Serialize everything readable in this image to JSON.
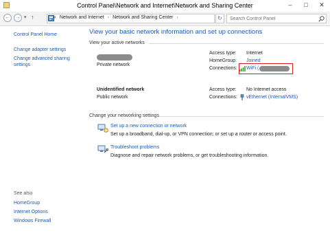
{
  "window": {
    "title": "Control Panel\\Network and Internet\\Network and Sharing Center",
    "minimize": "–",
    "maximize": "□",
    "close": "✕"
  },
  "nav": {
    "back": "←",
    "forward": "→",
    "dropdown": "▾",
    "up": "↑",
    "breadcrumb_chevron": "«",
    "breadcrumb": [
      "Network and Internet",
      "Network and Sharing Center"
    ],
    "separator": "›",
    "refresh": "↻",
    "search_placeholder": "Search Control Panel"
  },
  "sidebar": {
    "home": "Control Panel Home",
    "links": [
      "Change adapter settings",
      "Change advanced sharing settings"
    ],
    "see_also_title": "See also",
    "see_also": [
      "HomeGroup",
      "Internet Options",
      "Windows Firewall"
    ]
  },
  "main": {
    "heading": "View your basic network information and set up connections",
    "active_networks_title": "View your active networks",
    "networks": [
      {
        "name": "",
        "category": "Private network",
        "access_type_label": "Access type:",
        "access_type": "Internet",
        "homegroup_label": "HomeGroup:",
        "homegroup": "Joined",
        "connections_label": "Connections:",
        "connection": "WiFi ("
      },
      {
        "name": "Unidentified network",
        "category": "Public network",
        "access_type_label": "Access type:",
        "access_type": "No Internet access",
        "connections_label": "Connections:",
        "connection": "vEthernet (InternalVMS)"
      }
    ],
    "change_settings_title": "Change your networking settings",
    "settings": [
      {
        "link": "Set up a new connection or network",
        "desc": "Set up a broadband, dial-up, or VPN connection; or set up a router or access point."
      },
      {
        "link": "Troubleshoot problems",
        "desc": "Diagnose and repair network problems, or get troubleshooting information."
      }
    ]
  },
  "colors": {
    "link": "#1c5bb3",
    "highlight": "#d21e1e"
  }
}
